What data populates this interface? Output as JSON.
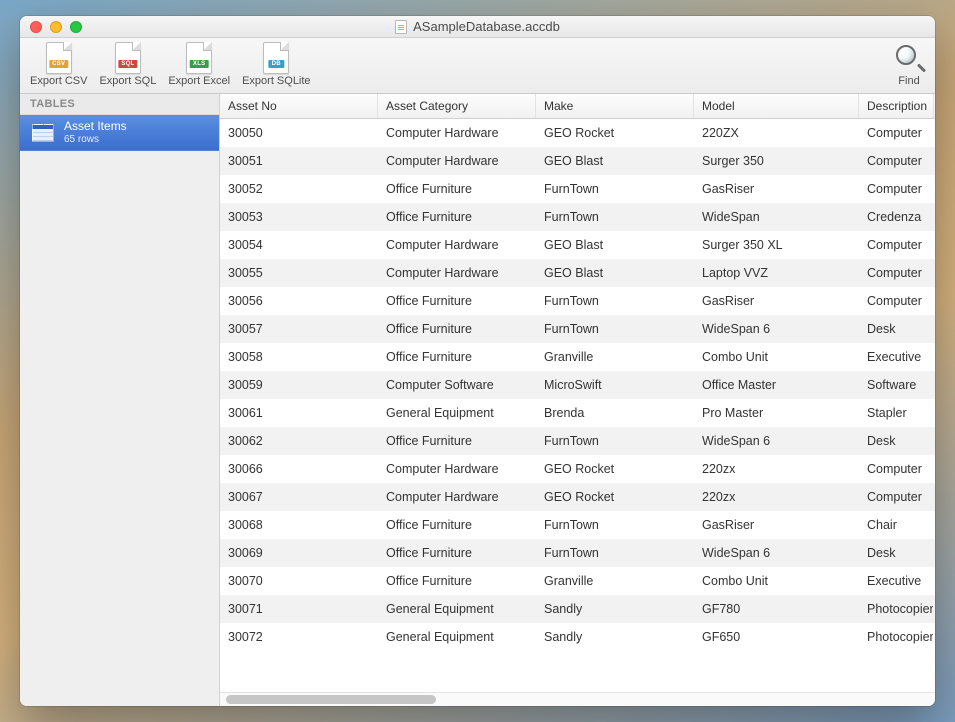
{
  "window": {
    "title": "ASampleDatabase.accdb"
  },
  "toolbar": {
    "export_csv": "Export CSV",
    "export_sql": "Export SQL",
    "export_excel": "Export Excel",
    "export_sqlite": "Export SQLite",
    "find": "Find"
  },
  "sidebar": {
    "heading": "TABLES",
    "items": [
      {
        "name": "Asset Items",
        "rowcount": "65 rows"
      }
    ]
  },
  "table": {
    "columns": [
      "Asset No",
      "Asset Category",
      "Make",
      "Model",
      "Description"
    ],
    "rows": [
      [
        "30050",
        "Computer Hardware",
        "GEO Rocket",
        "220ZX",
        "Computer"
      ],
      [
        "30051",
        "Computer Hardware",
        "GEO Blast",
        "Surger 350",
        "Computer"
      ],
      [
        "30052",
        "Office Furniture",
        "FurnTown",
        "GasRiser",
        "Computer"
      ],
      [
        "30053",
        "Office Furniture",
        "FurnTown",
        "WideSpan",
        "Credenza"
      ],
      [
        "30054",
        "Computer Hardware",
        "GEO Blast",
        "Surger 350 XL",
        "Computer"
      ],
      [
        "30055",
        "Computer Hardware",
        "GEO Blast",
        "Laptop VVZ",
        "Computer"
      ],
      [
        "30056",
        "Office Furniture",
        "FurnTown",
        "GasRiser",
        "Computer"
      ],
      [
        "30057",
        "Office Furniture",
        "FurnTown",
        "WideSpan 6",
        "Desk"
      ],
      [
        "30058",
        "Office Furniture",
        "Granville",
        "Combo Unit",
        "Executive"
      ],
      [
        "30059",
        "Computer Software",
        "MicroSwift",
        "Office Master",
        "Software"
      ],
      [
        "30061",
        "General Equipment",
        "Brenda",
        "Pro Master",
        "Stapler"
      ],
      [
        "30062",
        "Office Furniture",
        "FurnTown",
        "WideSpan 6",
        "Desk"
      ],
      [
        "30066",
        "Computer Hardware",
        "GEO Rocket",
        "220zx",
        "Computer"
      ],
      [
        "30067",
        "Computer Hardware",
        "GEO Rocket",
        "220zx",
        "Computer"
      ],
      [
        "30068",
        "Office Furniture",
        "FurnTown",
        "GasRiser",
        "Chair"
      ],
      [
        "30069",
        "Office Furniture",
        "FurnTown",
        "WideSpan 6",
        "Desk"
      ],
      [
        "30070",
        "Office Furniture",
        "Granville",
        "Combo Unit",
        "Executive"
      ],
      [
        "30071",
        "General Equipment",
        "Sandly",
        "GF780",
        "Photocopier"
      ],
      [
        "30072",
        "General Equipment",
        "Sandly",
        "GF650",
        "Photocopier"
      ]
    ]
  }
}
